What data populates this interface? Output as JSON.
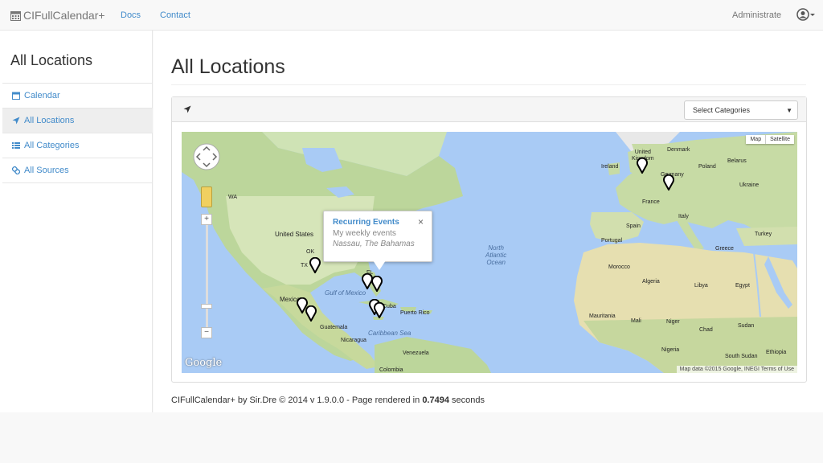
{
  "nav": {
    "brand": "CIFullCalendar+",
    "docs": "Docs",
    "contact": "Contact",
    "user_label": "Administrate"
  },
  "sidebar": {
    "title": "All Locations",
    "items": [
      {
        "label": "Calendar",
        "icon": "calendar-icon"
      },
      {
        "label": "All Locations",
        "icon": "location-arrow-icon"
      },
      {
        "label": "All Categories",
        "icon": "list-icon"
      },
      {
        "label": "All Sources",
        "icon": "link-icon"
      }
    ]
  },
  "main": {
    "title": "All Locations",
    "category_select": "Select Categories"
  },
  "map": {
    "type_map": "Map",
    "type_satellite": "Satellite",
    "logo": "Google",
    "attribution": "Map data ©2015 Google, INEGI   Terms of Use",
    "labels": {
      "united_states": "United States",
      "mexico": "Mexico",
      "gulf": "Gulf of Mexico",
      "cuba": "Cuba",
      "puerto_rico": "Puerto Rico",
      "guatemala": "Guatemala",
      "nicaragua": "Nicaragua",
      "caribbean": "Caribbean Sea",
      "venezuela": "Venezuela",
      "colombia": "Colombia",
      "north_atlantic": "North\nAtlantic\nOcean",
      "uk": "United\nKingdom",
      "denmark": "Denmark",
      "ireland": "Ireland",
      "poland": "Poland",
      "belarus": "Belarus",
      "germany": "Germany",
      "ukraine": "Ukraine",
      "france": "France",
      "italy": "Italy",
      "spain": "Spain",
      "portugal": "Portugal",
      "turkey": "Turkey",
      "greece": "Greece",
      "morocco": "Morocco",
      "algeria": "Algeria",
      "libya": "Libya",
      "egypt": "Egypt",
      "mauritania": "Mauritania",
      "mali": "Mali",
      "niger": "Niger",
      "chad": "Chad",
      "sudan": "Sudan",
      "nigeria": "Nigeria",
      "south_sudan": "South Sudan",
      "ethiopia": "Ethiopia",
      "wa": "WA",
      "tx": "TX",
      "ok": "OK",
      "fl": "FL"
    }
  },
  "popup": {
    "title": "Recurring Events",
    "subtitle": "My weekly events",
    "location": "Nassau, The Bahamas",
    "close": "×"
  },
  "footer": {
    "text": "CIFullCalendar+ by Sir.Dre © 2014 v 1.9.0.0 - Page rendered in ",
    "time": "0.7494",
    "suffix": " seconds"
  }
}
